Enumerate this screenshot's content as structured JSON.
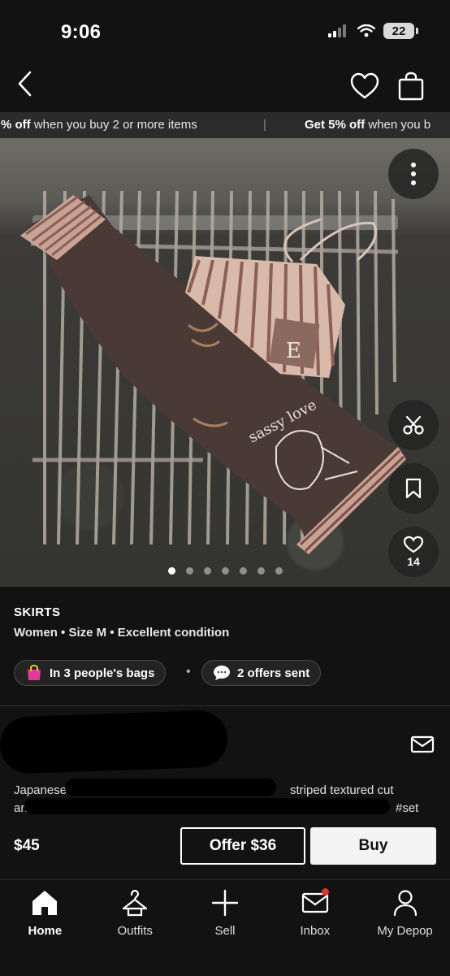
{
  "status": {
    "time": "9:06",
    "battery": "22"
  },
  "promo": {
    "segments": [
      {
        "bold": "% off",
        "rest": " when you buy 2 or more items"
      },
      {
        "bold": "Get 5% off",
        "rest": " when you b"
      }
    ],
    "separator": "|"
  },
  "photo": {
    "likes": "14",
    "slides": 7,
    "active_slide": 1
  },
  "item": {
    "category": "SKIRTS",
    "attributes": "Women • Size M • Excellent condition",
    "bags_text": "In 3 people's bags",
    "offers_text": "2 offers sent",
    "bullet": "•",
    "description_visible_start": "Japanese br",
    "description_visible_end": "striped textured cut",
    "description_line2_start": "and",
    "description_line2_end": "#set"
  },
  "purchase": {
    "price": "$45",
    "offer_label": "Offer $36",
    "buy_label": "Buy"
  },
  "nav": {
    "items": [
      {
        "label": "Home",
        "icon": "home-icon",
        "active": true
      },
      {
        "label": "Outfits",
        "icon": "hanger-icon"
      },
      {
        "label": "Sell",
        "icon": "plus-icon"
      },
      {
        "label": "Inbox",
        "icon": "mail-icon"
      },
      {
        "label": "My Depop",
        "icon": "person-icon"
      }
    ]
  },
  "colors": {
    "background": "#121212",
    "accent": "#e0312b"
  }
}
